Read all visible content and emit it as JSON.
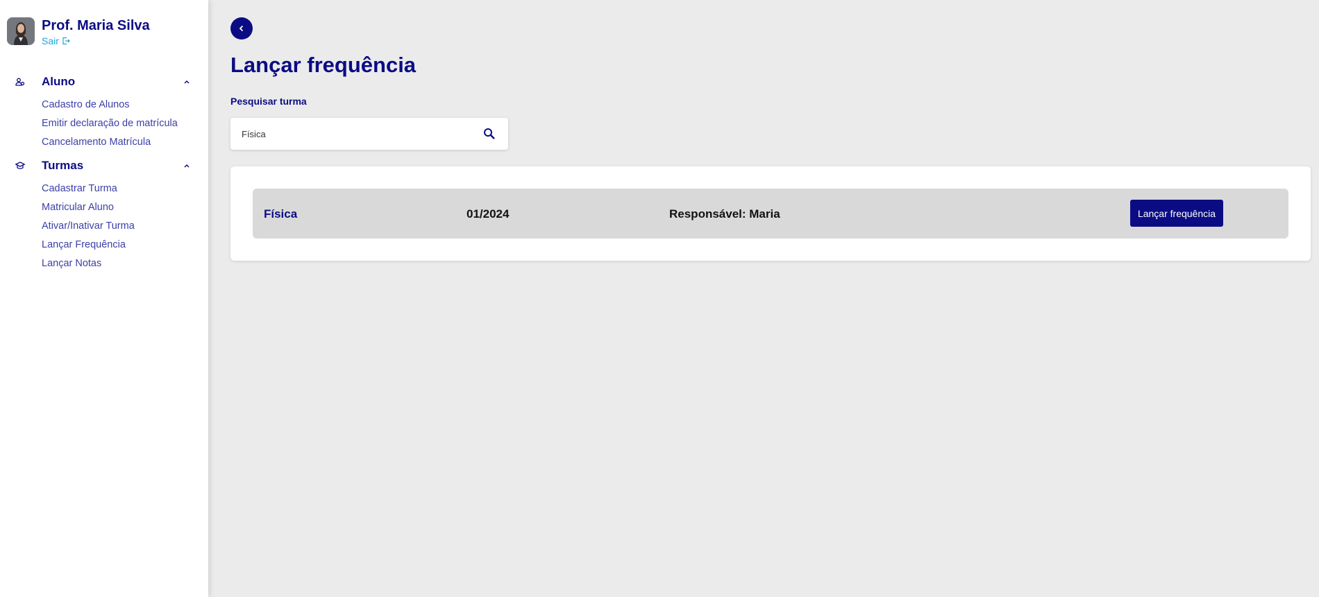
{
  "user": {
    "name": "Prof. Maria Silva",
    "logout_label": "Sair"
  },
  "sidebar": {
    "groups": [
      {
        "label": "Aluno",
        "icon": "users-icon",
        "items": [
          {
            "label": "Cadastro de Alunos"
          },
          {
            "label": "Emitir declaração de matrícula"
          },
          {
            "label": "Cancelamento Matrícula"
          }
        ]
      },
      {
        "label": "Turmas",
        "icon": "graduation-cap-icon",
        "items": [
          {
            "label": "Cadastrar Turma"
          },
          {
            "label": "Matricular Aluno"
          },
          {
            "label": "Ativar/Inativar Turma"
          },
          {
            "label": "Lançar Frequência"
          },
          {
            "label": "Lançar Notas"
          }
        ]
      }
    ]
  },
  "page": {
    "title": "Lançar frequência",
    "search_label": "Pesquisar turma",
    "search_value": "Física"
  },
  "results": [
    {
      "name": "Física",
      "period": "01/2024",
      "responsible": "Responsável: Maria",
      "action": "Lançar frequência"
    }
  ],
  "colors": {
    "primary": "#0b0c84",
    "link": "#1ba5e0",
    "background": "#ebebeb",
    "row": "#d9d9d9"
  }
}
